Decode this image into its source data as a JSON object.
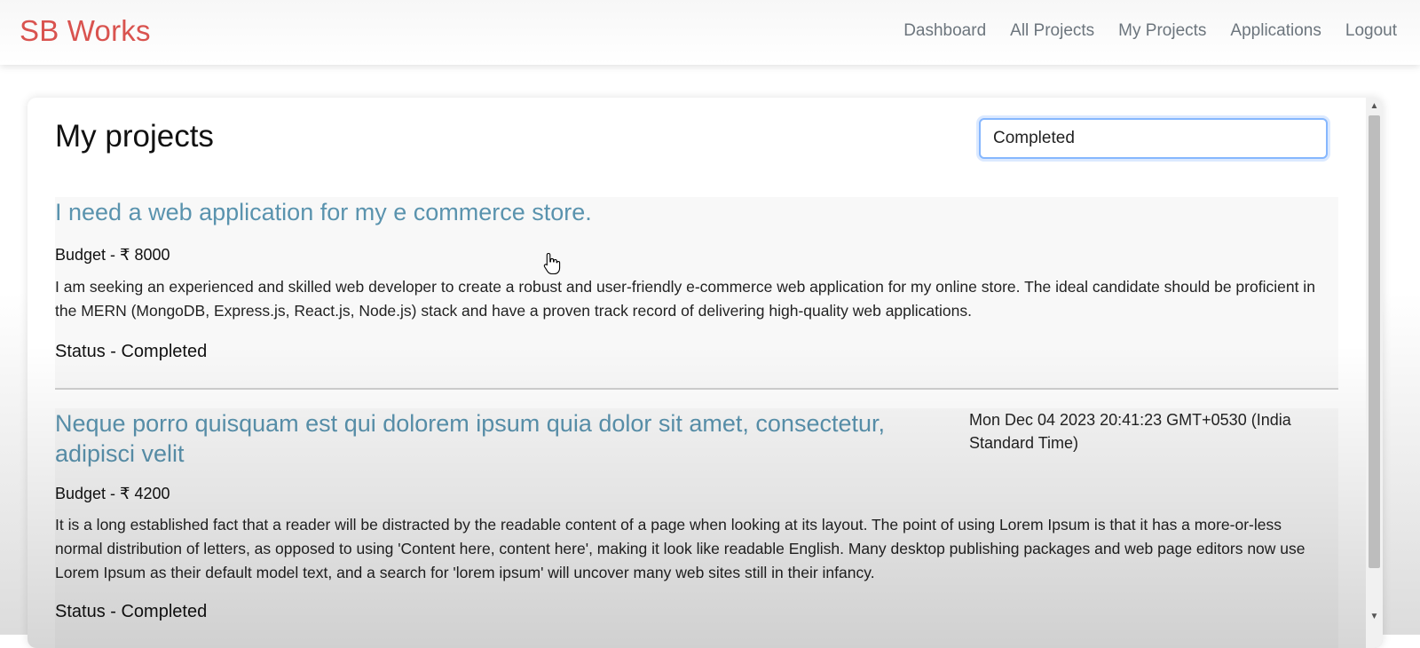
{
  "navbar": {
    "brand": "SB Works",
    "links": [
      "Dashboard",
      "All Projects",
      "My Projects",
      "Applications",
      "Logout"
    ]
  },
  "main": {
    "title": "My projects",
    "filter": {
      "selected": "Completed"
    },
    "projects": [
      {
        "title": "I need a web application for my e commerce store.",
        "date": "",
        "budget": "Budget - ₹ 8000",
        "description": "I am seeking an experienced and skilled web developer to create a robust and user-friendly e-commerce web application for my online store. The ideal candidate should be proficient in the MERN (MongoDB, Express.js, React.js, Node.js) stack and have a proven track record of delivering high-quality web applications.",
        "status": "Status - Completed"
      },
      {
        "title": "Neque porro quisquam est qui dolorem ipsum quia dolor sit amet, consectetur, adipisci velit",
        "date": "Mon Dec 04 2023 20:41:23 GMT+0530 (India Standard Time)",
        "budget": "Budget - ₹ 4200",
        "description": "It is a long established fact that a reader will be distracted by the readable content of a page when looking at its layout. The point of using Lorem Ipsum is that it has a more-or-less normal distribution of letters, as opposed to using 'Content here, content here', making it look like readable English. Many desktop publishing packages and web page editors now use Lorem Ipsum as their default model text, and a search for 'lorem ipsum' will uncover many web sites still in their infancy.",
        "status": "Status - Completed"
      }
    ]
  },
  "colors": {
    "brand": "#d9534f",
    "project_title": "#5a93ae",
    "nav_link": "#6c757d",
    "focus_border": "#86b7fe"
  },
  "icons": {
    "cursor": "hand-pointer-icon",
    "scroll_up": "triangle-up-icon",
    "scroll_down": "triangle-down-icon"
  }
}
